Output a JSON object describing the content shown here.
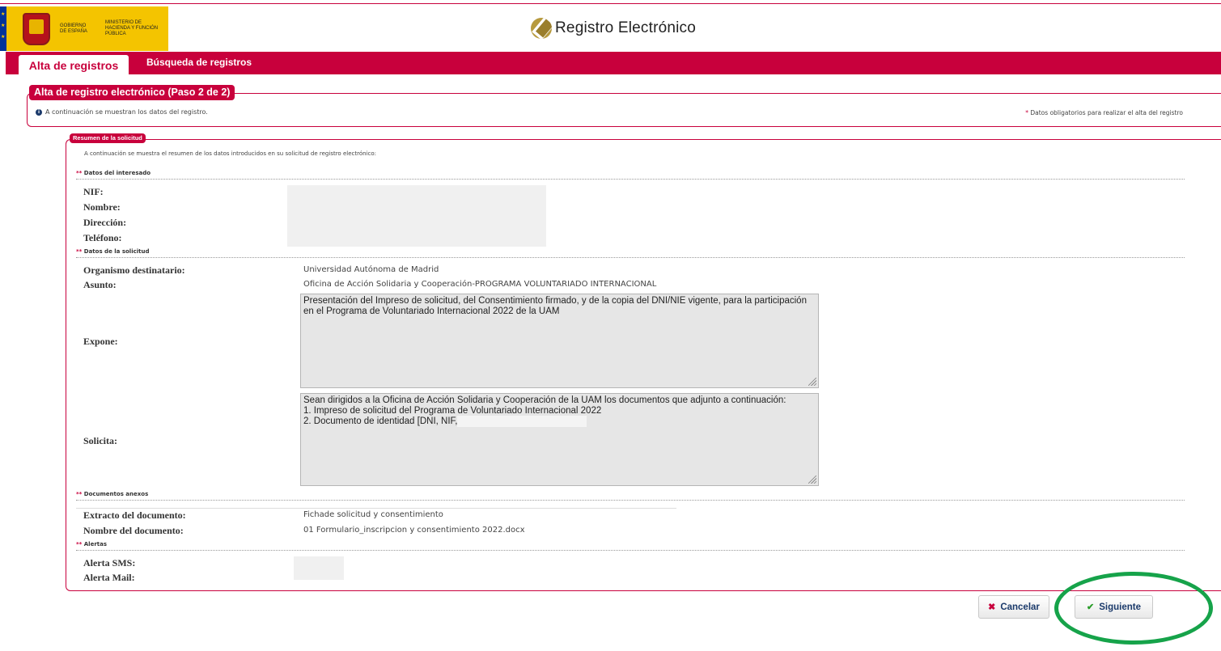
{
  "header": {
    "gov_line1": "Gobierno de España",
    "gov_line2": "Ministerio de Hacienda y Función Pública",
    "app_title": "Registro Electrónico"
  },
  "tabs": [
    {
      "label": "Alta de registros",
      "active": true
    },
    {
      "label": "Búsqueda de registros",
      "active": false
    }
  ],
  "panel": {
    "title": "Alta de registro electrónico (Paso 2 de 2)",
    "info": "A continuación se muestran los datos del registro.",
    "required_note": "Datos obligatorios para realizar el alta del registro"
  },
  "summary": {
    "title": "Resumen de la solicitud",
    "intro": "A continuación se muestra el resumen de los datos introducidos en su solicitud de registro electrónico:",
    "interesado": {
      "heading": "Datos del interesado",
      "nif_label": "NIF:",
      "nombre_label": "Nombre:",
      "direccion_label": "Dirección:",
      "telefono_label": "Teléfono:"
    },
    "solicitud": {
      "heading": "Datos de la solicitud",
      "organismo_label": "Organismo destinatario:",
      "organismo_value": "Universidad Autónoma de Madrid",
      "asunto_label": "Asunto:",
      "asunto_value": "Oficina de Acción Solidaria y Cooperación-PROGRAMA VOLUNTARIADO INTERNACIONAL",
      "expone_label": "Expone:",
      "expone_value": "Presentación del Impreso de solicitud, del Consentimiento firmado, y de la copia del DNI/NIE vigente, para la participación en el Programa de Voluntariado Internacional 2022 de la UAM",
      "solicita_label": "Solicita:",
      "solicita_line1": "Sean dirigidos a la Oficina de Acción Solidaria y Cooperación de la UAM los documentos que adjunto a continuación:",
      "solicita_line2": "1. Impreso de solicitud del Programa de Voluntariado Internacional 2022",
      "solicita_line3": "2. Documento de identidad [DNI, NIF,"
    },
    "anexos": {
      "heading": "Documentos anexos",
      "extracto_label": "Extracto del documento:",
      "extracto_value": "Fichade solicitud y consentimiento",
      "nombre_doc_label": "Nombre del documento:",
      "nombre_doc_value": "01 Formulario_inscripcion y consentimiento 2022.docx"
    },
    "alertas": {
      "heading": "Alertas",
      "sms_label": "Alerta SMS:",
      "mail_label": "Alerta Mail:"
    }
  },
  "buttons": {
    "cancel": "Cancelar",
    "next": "Siguiente"
  },
  "colors": {
    "brand_red": "#c8003c",
    "highlight_green": "#16a34a"
  }
}
